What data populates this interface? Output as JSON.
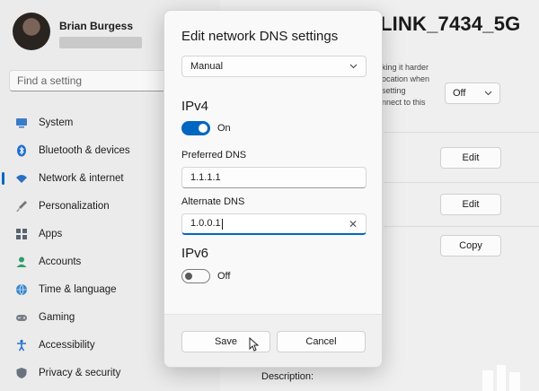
{
  "profile": {
    "name": "Brian Burgess"
  },
  "search": {
    "placeholder": "Find a setting"
  },
  "sidebar": {
    "items": [
      {
        "label": "System",
        "icon": "monitor-icon"
      },
      {
        "label": "Bluetooth & devices",
        "icon": "bluetooth-icon"
      },
      {
        "label": "Network & internet",
        "icon": "wifi-icon",
        "active": true
      },
      {
        "label": "Personalization",
        "icon": "brush-icon"
      },
      {
        "label": "Apps",
        "icon": "apps-icon"
      },
      {
        "label": "Accounts",
        "icon": "person-icon"
      },
      {
        "label": "Time & language",
        "icon": "globe-icon"
      },
      {
        "label": "Gaming",
        "icon": "gamepad-icon"
      },
      {
        "label": "Accessibility",
        "icon": "accessibility-icon"
      },
      {
        "label": "Privacy & security",
        "icon": "shield-icon"
      }
    ]
  },
  "main": {
    "title": "LINK_7434_5G",
    "privacy_lines": [
      "king it harder",
      "ocation when",
      "setting",
      "nnect to this"
    ],
    "metered_value": "Off",
    "edit_button_1": "Edit",
    "edit_button_2": "Edit",
    "copy_button": "Copy",
    "description_label": "Description:"
  },
  "dialog": {
    "title": "Edit network DNS settings",
    "mode_value": "Manual",
    "ipv4": {
      "heading": "IPv4",
      "toggle_state": "On",
      "preferred_label": "Preferred DNS",
      "preferred_value": "1.1.1.1",
      "alternate_label": "Alternate DNS",
      "alternate_value": "1.0.0.1"
    },
    "ipv6": {
      "heading": "IPv6",
      "toggle_state": "Off"
    },
    "save_label": "Save",
    "cancel_label": "Cancel"
  },
  "colors": {
    "accent": "#0067c0"
  }
}
